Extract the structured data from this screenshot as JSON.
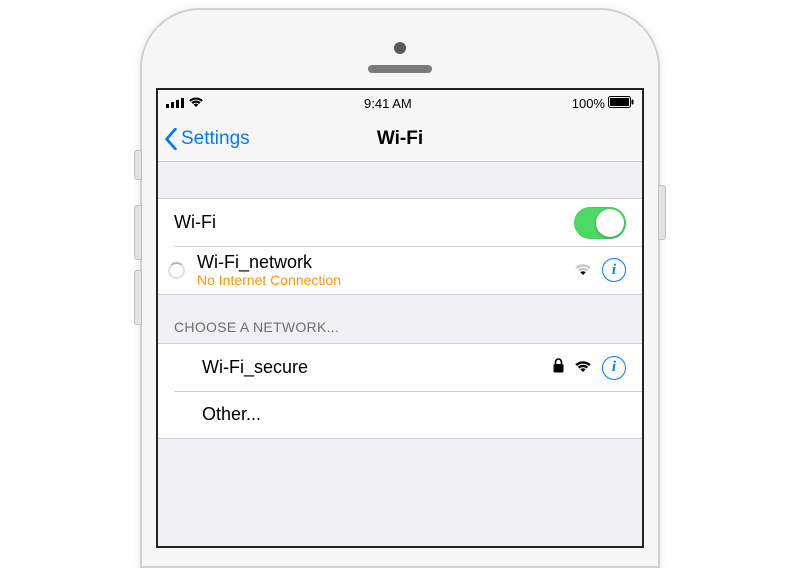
{
  "status": {
    "time": "9:41 AM",
    "battery": "100%"
  },
  "nav": {
    "back": "Settings",
    "title": "Wi-Fi"
  },
  "wifi_toggle": {
    "label": "Wi-Fi",
    "on": true
  },
  "connected": {
    "name": "Wi-Fi_network",
    "status": "No Internet Connection"
  },
  "choose_header": "CHOOSE A NETWORK...",
  "networks": [
    {
      "name": "Wi-Fi_secure",
      "secured": true
    }
  ],
  "other": "Other...",
  "colors": {
    "link": "#007aff",
    "warning": "#ff9500",
    "toggle_on": "#4cd964"
  }
}
